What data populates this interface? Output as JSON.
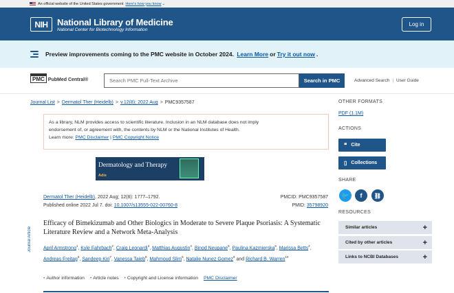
{
  "gov_banner": {
    "text": "An official website of the United States government",
    "know_link": "Here's how you know"
  },
  "header": {
    "logo": "NIH",
    "title": "National Library of Medicine",
    "subtitle": "National Center for Biotechnology Information",
    "login_label": "Log in"
  },
  "preview_banner": {
    "text": "Preview improvements coming to the PMC website in October 2024.",
    "learn_more": "Learn More",
    "or": "or",
    "try_it": "Try it out now",
    "period": "."
  },
  "pmc": {
    "logo_box": "PMC",
    "logo_name": "PubMed Central®",
    "search_placeholder": "Search PMC Full-Text Archive",
    "search_button": "Search in PMC",
    "advanced_search": "Advanced Search",
    "user_guide": "User Guide"
  },
  "breadcrumb": {
    "items": [
      "Journal List",
      "Dermatol Ther (Heidelb)",
      "v.12(8); 2022 Aug",
      "PMC9357587"
    ]
  },
  "disclaimer": {
    "line1": "As a library, NLM provides access to scientific literature. Inclusion in an NLM database does not imply",
    "line2": "endorsement of, or agreement with, the contents by NLM or the National Institutes of Health.",
    "learn_more": "Learn more:",
    "link1": "PMC Disclaimer",
    "sep": "|",
    "link2": "PMC Copyright Notice"
  },
  "journal_banner": {
    "title": "Dermatology and Therapy",
    "publisher": "Adis"
  },
  "article": {
    "journal_link": "Dermatol Ther (Heidelb)",
    "citation": ", 2022 Aug; 12(8): 1777–1792.",
    "published": "Published online 2022 Jul 7. doi: ",
    "doi": "10.1007/s13555-022-00760-8",
    "pmcid_label": "PMCID: PMC9357587",
    "pmid_label": "PMID: ",
    "pmid": "35798920",
    "side_label": "Journal Article",
    "title": "Efficacy of Bimekizumab and Other Biologics in Moderate to Severe Plaque Psoriasis: A Systematic Literature Review and a Network Meta-Analysis",
    "authors": [
      {
        "name": "April Armstrong",
        "sup": "1"
      },
      {
        "name": "Kyle Fahrbach",
        "sup": "2"
      },
      {
        "name": "Craig Leonardi",
        "sup": "3"
      },
      {
        "name": "Matthias Augustin",
        "sup": "4"
      },
      {
        "name": "Binod Neupane",
        "sup": "5"
      },
      {
        "name": "Paulina Kazmierska",
        "sup": "6"
      },
      {
        "name": "Marissa Betts",
        "sup": "2"
      },
      {
        "name": "Andreas Freitag",
        "sup": "6"
      },
      {
        "name": "Sandeep Kiri",
        "sup": "7"
      },
      {
        "name": "Vanessa Taieb",
        "sup": "8"
      },
      {
        "name": "Mahmoud Slim",
        "sup": "5"
      },
      {
        "name": "Natalie Nunez Gomez",
        "sup": "9"
      },
      {
        "name": "Richard B. Warren",
        "sup": "10"
      }
    ],
    "author_and": "and",
    "links": [
      "Author information",
      "Article notes",
      "Copyright and License information"
    ],
    "disclaimer_link": "PMC Disclaimer"
  },
  "sidebar": {
    "other_formats": "OTHER FORMATS",
    "pdf": "PDF (1.1M)",
    "actions": "ACTIONS",
    "cite": "Cite",
    "collections": "Collections",
    "share": "SHARE",
    "resources": "RESOURCES",
    "resource_items": [
      "Similar articles",
      "Cited by other articles",
      "Links to NCBI Databases"
    ],
    "colors": {
      "twitter": "#1d9bf0",
      "facebook": "#20558a",
      "link": "#20558a"
    }
  }
}
